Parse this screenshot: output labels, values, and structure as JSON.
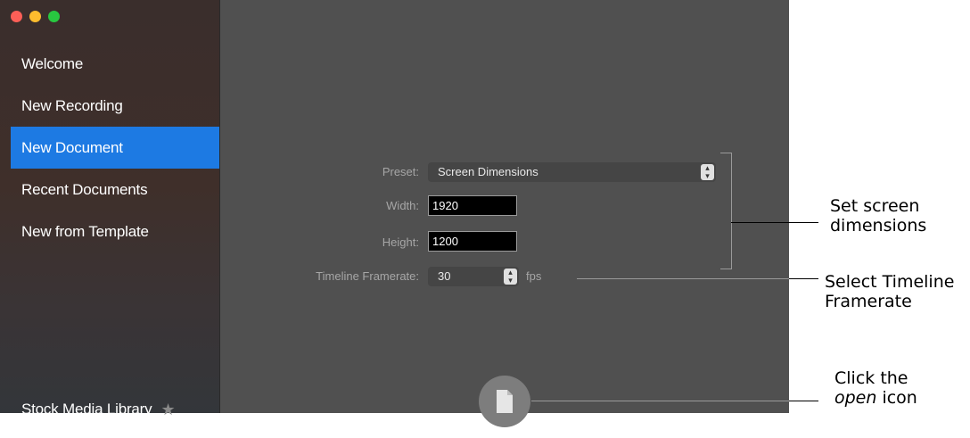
{
  "sidebar": {
    "items": [
      {
        "label": "Welcome",
        "active": false
      },
      {
        "label": "New Recording",
        "active": false
      },
      {
        "label": "New Document",
        "active": true
      },
      {
        "label": "Recent Documents",
        "active": false
      },
      {
        "label": "New from Template",
        "active": false
      }
    ],
    "stock_label": "Stock Media Library",
    "stock_icon": "star-icon"
  },
  "form": {
    "preset_label": "Preset:",
    "preset_value": "Screen Dimensions",
    "width_label": "Width:",
    "width_value": "1920",
    "height_label": "Height:",
    "height_value": "1200",
    "framerate_label": "Timeline Framerate:",
    "framerate_value": "30",
    "fps_unit": "fps"
  },
  "open_icon": "document-icon",
  "callouts": {
    "dimensions": [
      "Set screen",
      "dimensions"
    ],
    "framerate": [
      "Select Timeline",
      "Framerate"
    ],
    "open": {
      "line1": "Click the",
      "em": "open",
      "rest": " icon"
    }
  },
  "colors": {
    "accent": "#1d7ae3",
    "close": "#fc5f57",
    "minimize": "#fdbc2e",
    "zoom": "#28c840"
  }
}
